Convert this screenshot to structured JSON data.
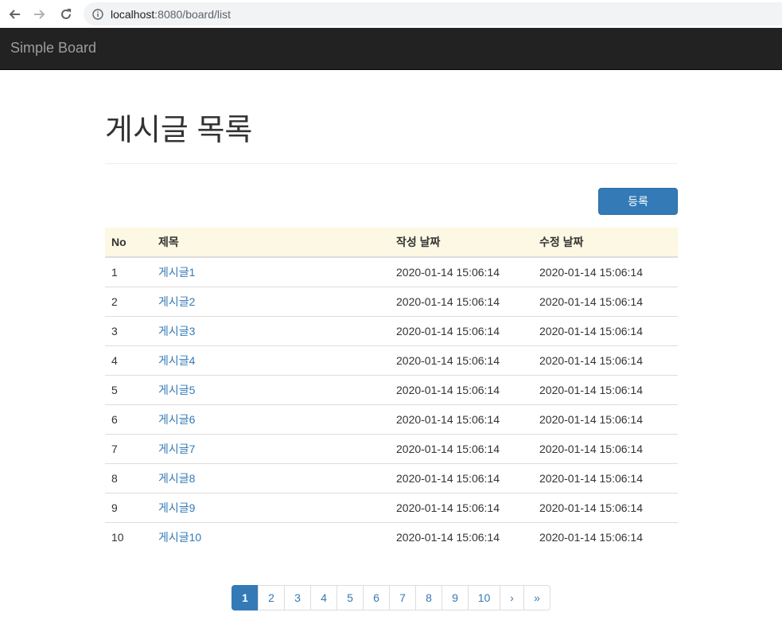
{
  "browser": {
    "url_host": "localhost",
    "url_rest": ":8080/board/list"
  },
  "navbar": {
    "brand": "Simple Board"
  },
  "page": {
    "title": "게시글 목록",
    "register_button": "등록"
  },
  "table": {
    "headers": [
      "No",
      "제목",
      "작성 날짜",
      "수정 날짜"
    ],
    "rows": [
      {
        "no": "1",
        "title": "게시글1",
        "created": "2020-01-14 15:06:14",
        "updated": "2020-01-14 15:06:14"
      },
      {
        "no": "2",
        "title": "게시글2",
        "created": "2020-01-14 15:06:14",
        "updated": "2020-01-14 15:06:14"
      },
      {
        "no": "3",
        "title": "게시글3",
        "created": "2020-01-14 15:06:14",
        "updated": "2020-01-14 15:06:14"
      },
      {
        "no": "4",
        "title": "게시글4",
        "created": "2020-01-14 15:06:14",
        "updated": "2020-01-14 15:06:14"
      },
      {
        "no": "5",
        "title": "게시글5",
        "created": "2020-01-14 15:06:14",
        "updated": "2020-01-14 15:06:14"
      },
      {
        "no": "6",
        "title": "게시글6",
        "created": "2020-01-14 15:06:14",
        "updated": "2020-01-14 15:06:14"
      },
      {
        "no": "7",
        "title": "게시글7",
        "created": "2020-01-14 15:06:14",
        "updated": "2020-01-14 15:06:14"
      },
      {
        "no": "8",
        "title": "게시글8",
        "created": "2020-01-14 15:06:14",
        "updated": "2020-01-14 15:06:14"
      },
      {
        "no": "9",
        "title": "게시글9",
        "created": "2020-01-14 15:06:14",
        "updated": "2020-01-14 15:06:14"
      },
      {
        "no": "10",
        "title": "게시글10",
        "created": "2020-01-14 15:06:14",
        "updated": "2020-01-14 15:06:14"
      }
    ]
  },
  "pagination": {
    "pages": [
      "1",
      "2",
      "3",
      "4",
      "5",
      "6",
      "7",
      "8",
      "9",
      "10"
    ],
    "active": "1",
    "next": "›",
    "last": "»"
  },
  "colors": {
    "primary": "#337ab7",
    "navbar": "#222222",
    "header_row": "#fcf8e3"
  },
  "icons": {
    "back": "arrow-left-icon",
    "forward": "arrow-right-icon",
    "reload": "reload-icon",
    "site_info": "info-icon"
  }
}
